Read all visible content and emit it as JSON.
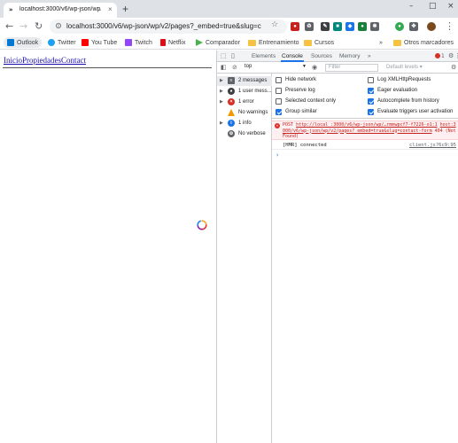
{
  "browser": {
    "tab_title": "localhost:3000/v6/wp-json/wp/v...",
    "url": "localhost:3000/v6/wp-json/wp/v2/pages?_embed=true&slug=co...",
    "tab_close": "×",
    "new_tab": "+",
    "window_controls": [
      "–",
      "□",
      "×"
    ]
  },
  "bookmarks": [
    {
      "label": "Outlook",
      "color": "#0078d4"
    },
    {
      "label": "Twitter",
      "color": "#1da1f2"
    },
    {
      "label": "You Tube",
      "color": "#ff0000"
    },
    {
      "label": "Twitch",
      "color": "#9146ff"
    },
    {
      "label": "Netflix",
      "color": "#e50914"
    },
    {
      "label": "Comparador",
      "color": "#4caf50"
    },
    {
      "label": "Entrenamiento",
      "color": "#f5c242"
    },
    {
      "label": "Cursos",
      "color": "#f5c242"
    }
  ],
  "bookmarks_more": "»",
  "other_bookmarks": "Otros marcadores",
  "page": {
    "nav_links": [
      "Inicio",
      "Propiedades",
      "Contact"
    ]
  },
  "devtools": {
    "tabs": [
      "Elements",
      "Console",
      "Sources",
      "Memory"
    ],
    "tabs_more": "»",
    "warning_count": "1",
    "context": "top",
    "filter_placeholder": "Filter",
    "levels": "Default levels ▾",
    "sidebar": [
      {
        "label": "2 messages",
        "icon": "list-icon"
      },
      {
        "label": "1 user mess...",
        "icon": "user-icon"
      },
      {
        "label": "1 error",
        "icon": "error-icon"
      },
      {
        "label": "No warnings",
        "icon": "warning-icon"
      },
      {
        "label": "1 info",
        "icon": "info-icon"
      },
      {
        "label": "No verbose",
        "icon": "verbose-icon"
      }
    ],
    "settings_left": [
      {
        "label": "Hide network",
        "checked": false
      },
      {
        "label": "Preserve log",
        "checked": false
      },
      {
        "label": "Selected context only",
        "checked": false
      },
      {
        "label": "Group similar",
        "checked": true
      }
    ],
    "settings_right": [
      {
        "label": "Log XMLHttpRequests",
        "checked": false
      },
      {
        "label": "Eager evaluation",
        "checked": true
      },
      {
        "label": "Autocomplete from history",
        "checked": true
      },
      {
        "label": "Evaluate triggers user activation",
        "checked": true
      }
    ],
    "error": {
      "method": "POST",
      "link_text": "http://local :3000/v6/wp-json/wp/…rmmwpcf7-f7226-o1:1",
      "continuation": "host:3000/v6/wp-json/wp/v2/pages?_embed=true&slug=contact-form",
      "status": "404 (Not Found)"
    },
    "hmr": {
      "text": "[HMR] connected",
      "source": "client.js?6c9:95"
    },
    "prompt": "›"
  },
  "colors": {
    "accent": "#1a73e8",
    "error": "#d93025",
    "link": "#1a0dab"
  }
}
